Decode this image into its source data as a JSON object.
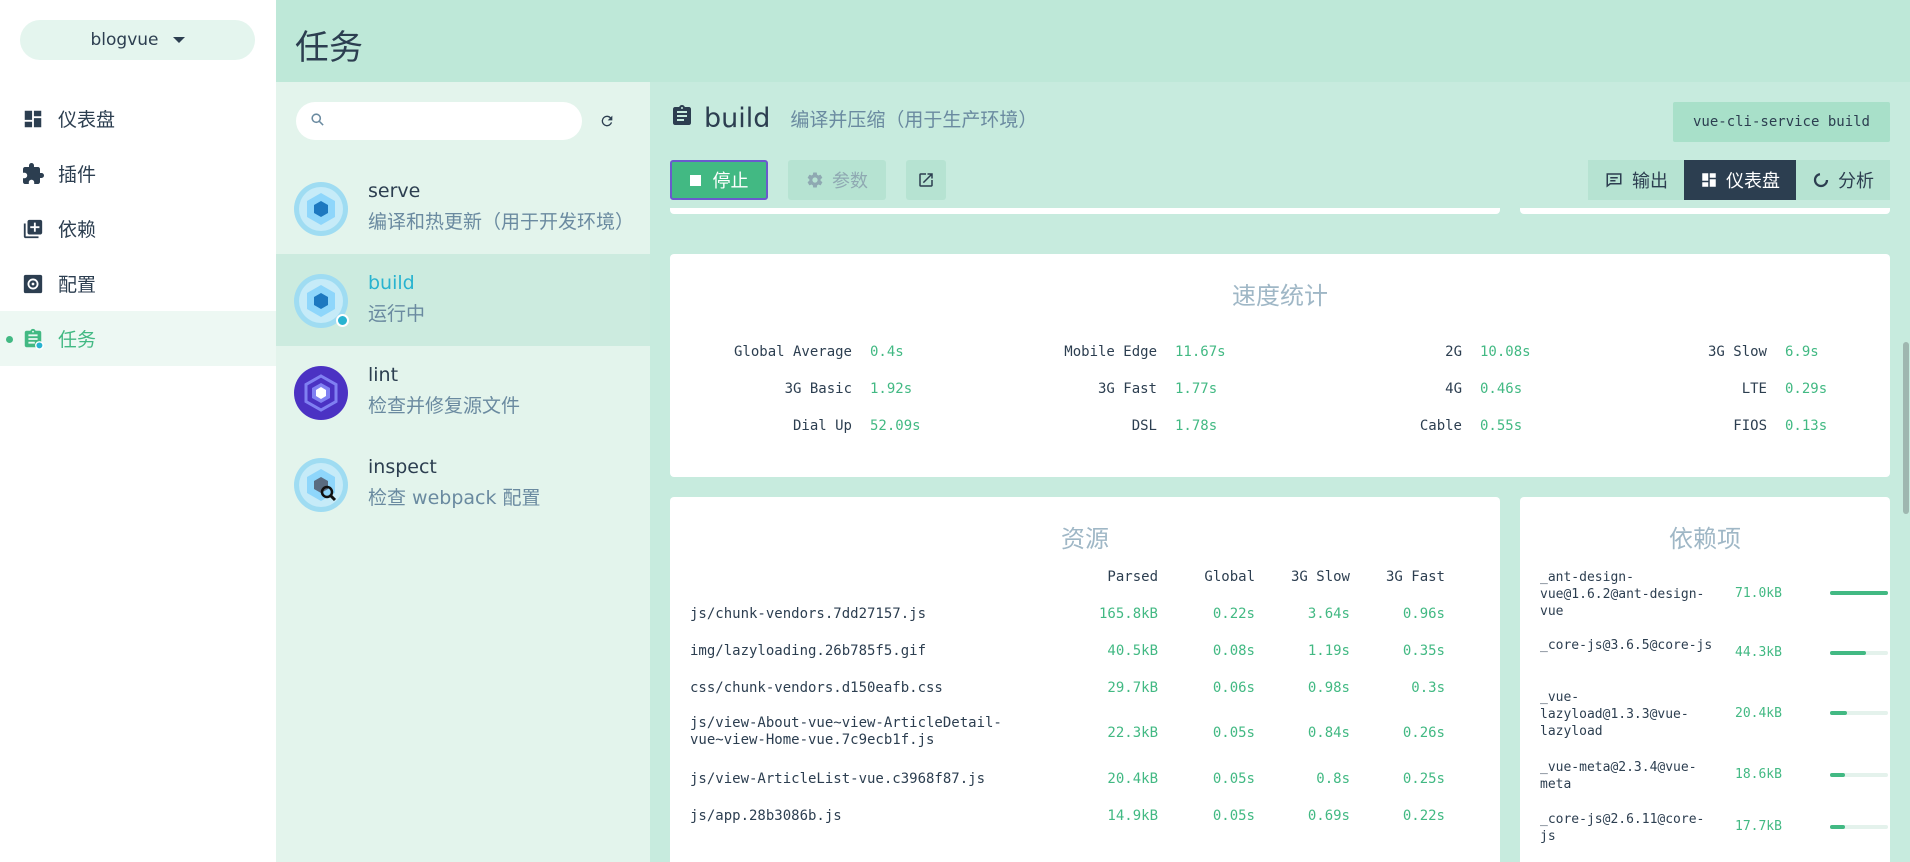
{
  "sidebar": {
    "project": "blogvue",
    "items": [
      {
        "label": "仪表盘",
        "icon": "dashboard-icon"
      },
      {
        "label": "插件",
        "icon": "puzzle-icon"
      },
      {
        "label": "依赖",
        "icon": "library-icon"
      },
      {
        "label": "配置",
        "icon": "settings-icon"
      },
      {
        "label": "任务",
        "icon": "assignment-icon",
        "active": true
      }
    ]
  },
  "header": {
    "title": "任务"
  },
  "tasks": [
    {
      "name": "serve",
      "desc": "编译和热更新（用于开发环境）"
    },
    {
      "name": "build",
      "desc": "运行中",
      "selected": true
    },
    {
      "name": "lint",
      "desc": "检查并修复源文件"
    },
    {
      "name": "inspect",
      "desc": "检查 webpack 配置"
    }
  ],
  "main": {
    "task_name": "build",
    "task_desc": "编译并压缩（用于生产环境）",
    "command": "vue-cli-service build",
    "stop_label": "停止",
    "params_label": "参数",
    "tabs": [
      {
        "label": "输出"
      },
      {
        "label": "仪表盘",
        "active": true
      },
      {
        "label": "分析"
      }
    ]
  },
  "speed": {
    "title": "速度统计",
    "rows": [
      [
        {
          "label": "Global Average",
          "value": "0.4s"
        },
        {
          "label": "Mobile Edge",
          "value": "11.67s"
        },
        {
          "label": "2G",
          "value": "10.08s"
        },
        {
          "label": "3G Slow",
          "value": "6.9s"
        }
      ],
      [
        {
          "label": "3G Basic",
          "value": "1.92s"
        },
        {
          "label": "3G Fast",
          "value": "1.77s"
        },
        {
          "label": "4G",
          "value": "0.46s"
        },
        {
          "label": "LTE",
          "value": "0.29s"
        }
      ],
      [
        {
          "label": "Dial Up",
          "value": "52.09s"
        },
        {
          "label": "DSL",
          "value": "1.78s"
        },
        {
          "label": "Cable",
          "value": "0.55s"
        },
        {
          "label": "FIOS",
          "value": "0.13s"
        }
      ]
    ]
  },
  "assets": {
    "title": "资源",
    "headers": [
      "Parsed",
      "Global",
      "3G Slow",
      "3G Fast"
    ],
    "rows": [
      {
        "name": "js/chunk-vendors.7dd27157.js",
        "parsed": "165.8kB",
        "global": "0.22s",
        "slow": "3.64s",
        "fast": "0.96s"
      },
      {
        "name": "img/lazyloading.26b785f5.gif",
        "parsed": "40.5kB",
        "global": "0.08s",
        "slow": "1.19s",
        "fast": "0.35s"
      },
      {
        "name": "css/chunk-vendors.d150eafb.css",
        "parsed": "29.7kB",
        "global": "0.06s",
        "slow": "0.98s",
        "fast": "0.3s"
      },
      {
        "name": "js/view-About-vue~view-ArticleDetail-vue~view-Home-vue.7c9ecb1f.js",
        "parsed": "22.3kB",
        "global": "0.05s",
        "slow": "0.84s",
        "fast": "0.26s"
      },
      {
        "name": "js/view-ArticleList-vue.c3968f87.js",
        "parsed": "20.4kB",
        "global": "0.05s",
        "slow": "0.8s",
        "fast": "0.25s"
      },
      {
        "name": "js/app.28b3086b.js",
        "parsed": "14.9kB",
        "global": "0.05s",
        "slow": "0.69s",
        "fast": "0.22s"
      }
    ]
  },
  "deps": {
    "title": "依赖项",
    "rows": [
      {
        "name": "_ant-design-vue@1.6.2@ant-design-vue",
        "size": "71.0kB",
        "fraction": 1.0
      },
      {
        "name": "_core-js@3.6.5@core-js",
        "size": "44.3kB",
        "fraction": 0.62
      },
      {
        "name": "_vue-lazyload@1.3.3@vue-lazyload",
        "size": "20.4kB",
        "fraction": 0.29
      },
      {
        "name": "_vue-meta@2.3.4@vue-meta",
        "size": "18.6kB",
        "fraction": 0.26
      },
      {
        "name": "_core-js@2.6.11@core-js",
        "size": "17.7kB",
        "fraction": 0.25
      }
    ]
  }
}
